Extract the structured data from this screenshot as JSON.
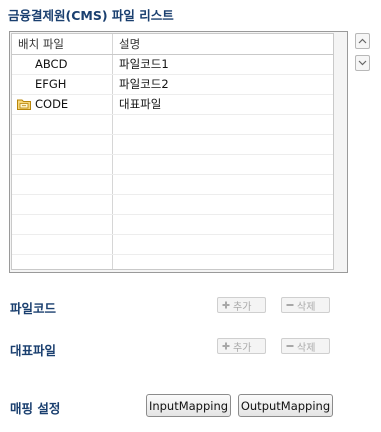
{
  "title": "금융결제원(CMS) 파일 리스트",
  "table": {
    "columns": [
      "배치 파일",
      "설명"
    ],
    "rows": [
      {
        "name": "ABCD",
        "desc": "파일코드1",
        "icon": ""
      },
      {
        "name": "EFGH",
        "desc": "파일코드2",
        "icon": ""
      },
      {
        "name": "CODE",
        "desc": "대표파일",
        "icon": "folder-icon"
      }
    ]
  },
  "sections": {
    "file_code": {
      "label": "파일코드",
      "add": "추가",
      "remove": "삭제"
    },
    "rep_file": {
      "label": "대표파일",
      "add": "추가",
      "remove": "삭제"
    }
  },
  "mapping": {
    "label": "매핑 설정",
    "input": "InputMapping",
    "output": "OutputMapping"
  }
}
